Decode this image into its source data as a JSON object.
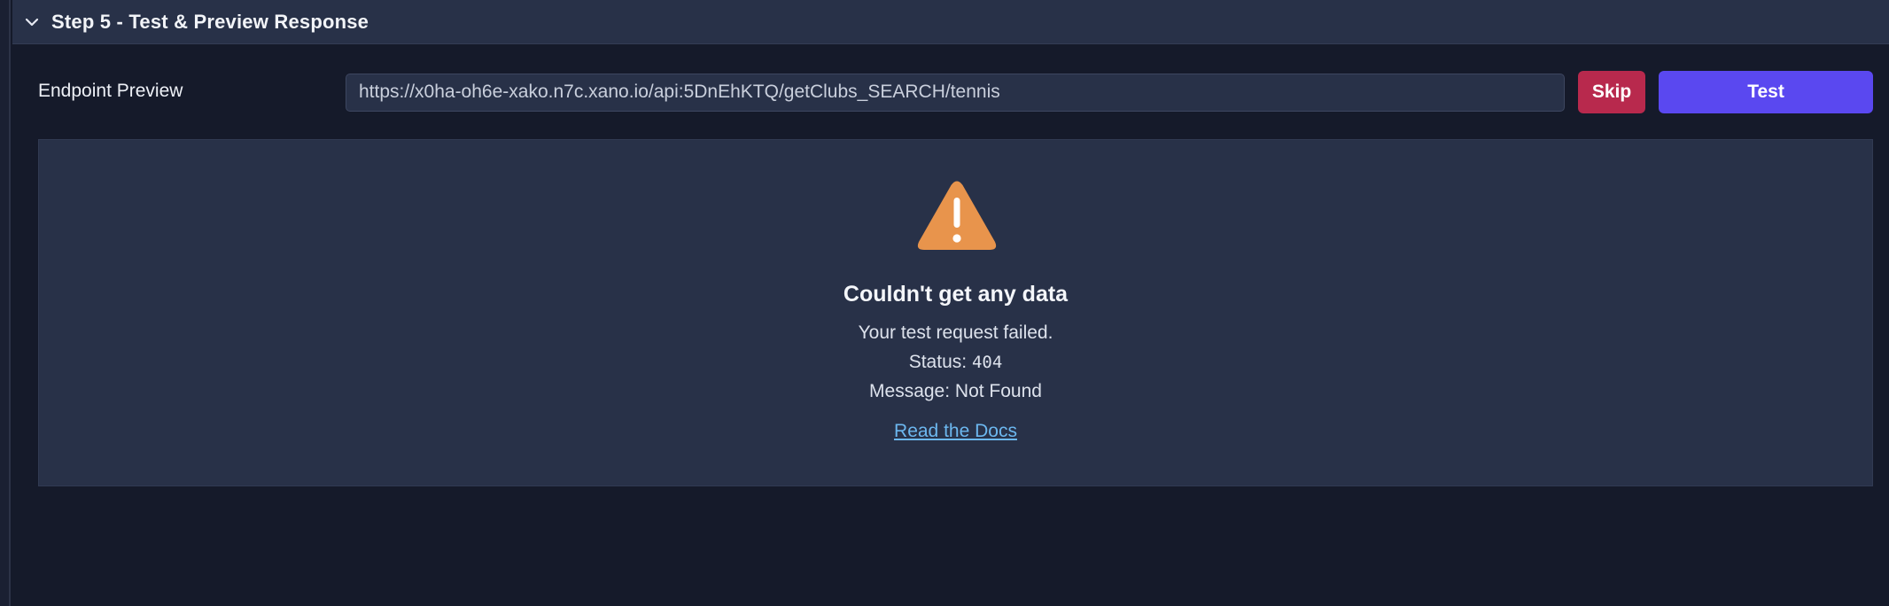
{
  "step": {
    "title": "Step 5 - Test & Preview Response"
  },
  "endpoint": {
    "label": "Endpoint Preview",
    "url": "https://x0ha-oh6e-xako.n7c.xano.io/api:5DnEhKTQ/getClubs_SEARCH/tennis"
  },
  "buttons": {
    "skip_label": "Skip",
    "test_label": "Test"
  },
  "result": {
    "icon": "warning-triangle-icon",
    "title": "Couldn't get any data",
    "message_line": "Your test request failed.",
    "status_label": "Status:",
    "status_code": "404",
    "message_label": "Message:",
    "message_value": "Not Found",
    "docs_link": "Read the Docs"
  },
  "colors": {
    "skip": "#b8294d",
    "test": "#5a48f0",
    "warning": "#e8944c",
    "link": "#6cb7ef"
  }
}
